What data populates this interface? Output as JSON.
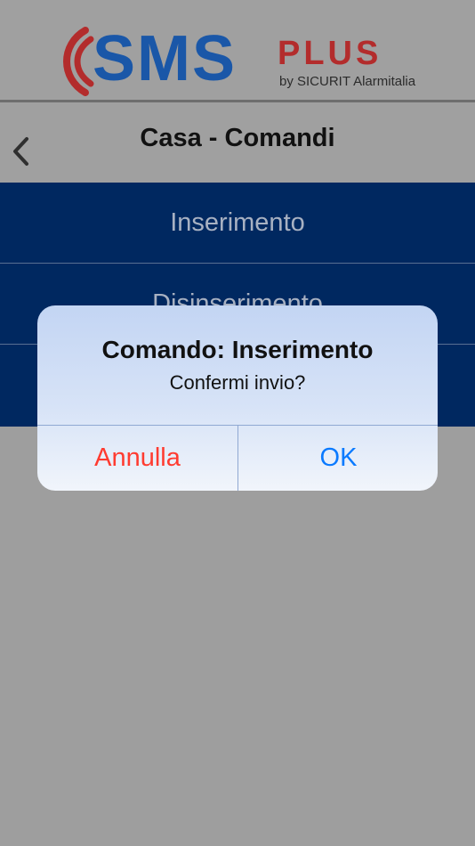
{
  "logo": {
    "brand": "SMS",
    "suffix": "PLUS",
    "byline": "by SICURIT Alarmitalia",
    "brand_color": "#1a57a8",
    "accent_color": "#b32c2c"
  },
  "nav": {
    "back_icon": "chevron-left-icon",
    "title": "Casa - Comandi"
  },
  "commands": {
    "items": [
      {
        "label": "Inserimento"
      },
      {
        "label": "Disinserimento"
      },
      {
        "label": ""
      }
    ],
    "row_color": "#002860"
  },
  "alert": {
    "title": "Comando: Inserimento",
    "message": "Confermi invio?",
    "cancel_label": "Annulla",
    "ok_label": "OK",
    "cancel_color": "#ff3b30",
    "ok_color": "#0a7aff"
  }
}
